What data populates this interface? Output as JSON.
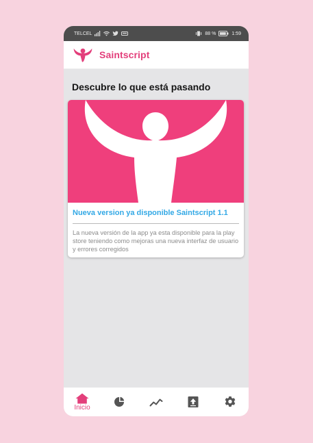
{
  "status_bar": {
    "carrier": "TELCEL",
    "battery": "88 %",
    "time": "1:59"
  },
  "app_bar": {
    "title": "Saintscript"
  },
  "feed": {
    "heading": "Descubre lo que está pasando",
    "cards": [
      {
        "title": "Nueva version ya disponible Saintscript 1.1",
        "body": "La nueva versión de la app ya esta disponible para la play store teniendo como mejoras una nueva interfaz de usuario y errores corregidos"
      }
    ]
  },
  "bottom_nav": {
    "home_label": "Inicio",
    "items": [
      {
        "icon": "home-icon"
      },
      {
        "icon": "pie-chart-icon"
      },
      {
        "icon": "trend-icon"
      },
      {
        "icon": "upload-icon"
      },
      {
        "icon": "gear-icon"
      }
    ]
  },
  "colors": {
    "accent": "#e33f7b",
    "link": "#32a8e5",
    "page_background": "#f8d3df"
  }
}
